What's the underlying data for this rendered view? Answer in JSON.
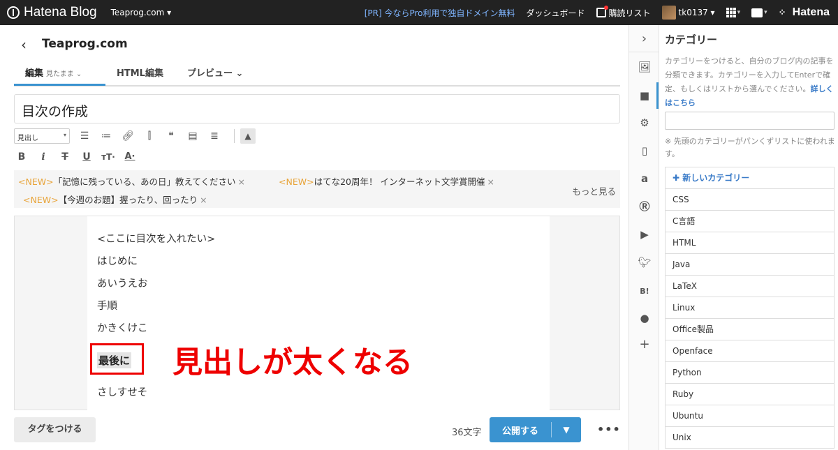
{
  "gnav": {
    "logo": "Hatena Blog",
    "blog_select": "Teaprog.com ▾",
    "pr": "[PR] 今ならPro利用で独自ドメイン無料",
    "dashboard": "ダッシュボード",
    "reader": "購読リスト",
    "user": "tk0137 ▾",
    "brand": "Hatena"
  },
  "header": {
    "back": "‹",
    "blog_title": "Teaprog.com"
  },
  "tabs": [
    {
      "label": "編集",
      "sub": "見たまま ⌄"
    },
    {
      "label": "HTML編集"
    },
    {
      "label": "プレビュー ⌄"
    }
  ],
  "entry": {
    "title": "目次の作成"
  },
  "toolbar": {
    "heading_select": "見出し"
  },
  "news": [
    {
      "tag": "<NEW>",
      "text": "「記憶に残っている、あの日」教えてください",
      "x": "×"
    },
    {
      "tag": "<NEW>",
      "text": "はてな20周年！ インターネット文学賞開催",
      "x": "×"
    },
    {
      "tag": "<NEW>",
      "text": "【今週のお題】握ったり、回ったり",
      "x": "×"
    }
  ],
  "news_more": "もっと見る",
  "body_lines": [
    "<ここに目次を入れたい>",
    "はじめに",
    "あいうえお",
    "手順",
    "かきくけこ"
  ],
  "highlight_heading": "最後に",
  "last_line": "さしすせそ",
  "annotation": "見出しが太くなる",
  "bottom": {
    "tag_button": "タグをつける",
    "char_count": "36文字",
    "publish": "公開する",
    "more": "•••"
  },
  "category_panel": {
    "title": "カテゴリー",
    "description": "カテゴリーをつけると、自分のブログ内の記事を分類できます。カテゴリーを入力してEnterで確定、もしくはリストから選んでください。",
    "link": "詳しくはこちら",
    "note": "※ 先頭のカテゴリーがパンくずリストに使われます。",
    "new_category": "✚ 新しいカテゴリー",
    "items": [
      "CSS",
      "C言語",
      "HTML",
      "Java",
      "LaTeX",
      "Linux",
      "Office製品",
      "Openface",
      "Python",
      "Ruby",
      "Ubuntu",
      "Unix"
    ]
  },
  "colors": {
    "accent": "#3a93d0",
    "annotation": "#e00000",
    "new_tag": "#e8a43a"
  }
}
